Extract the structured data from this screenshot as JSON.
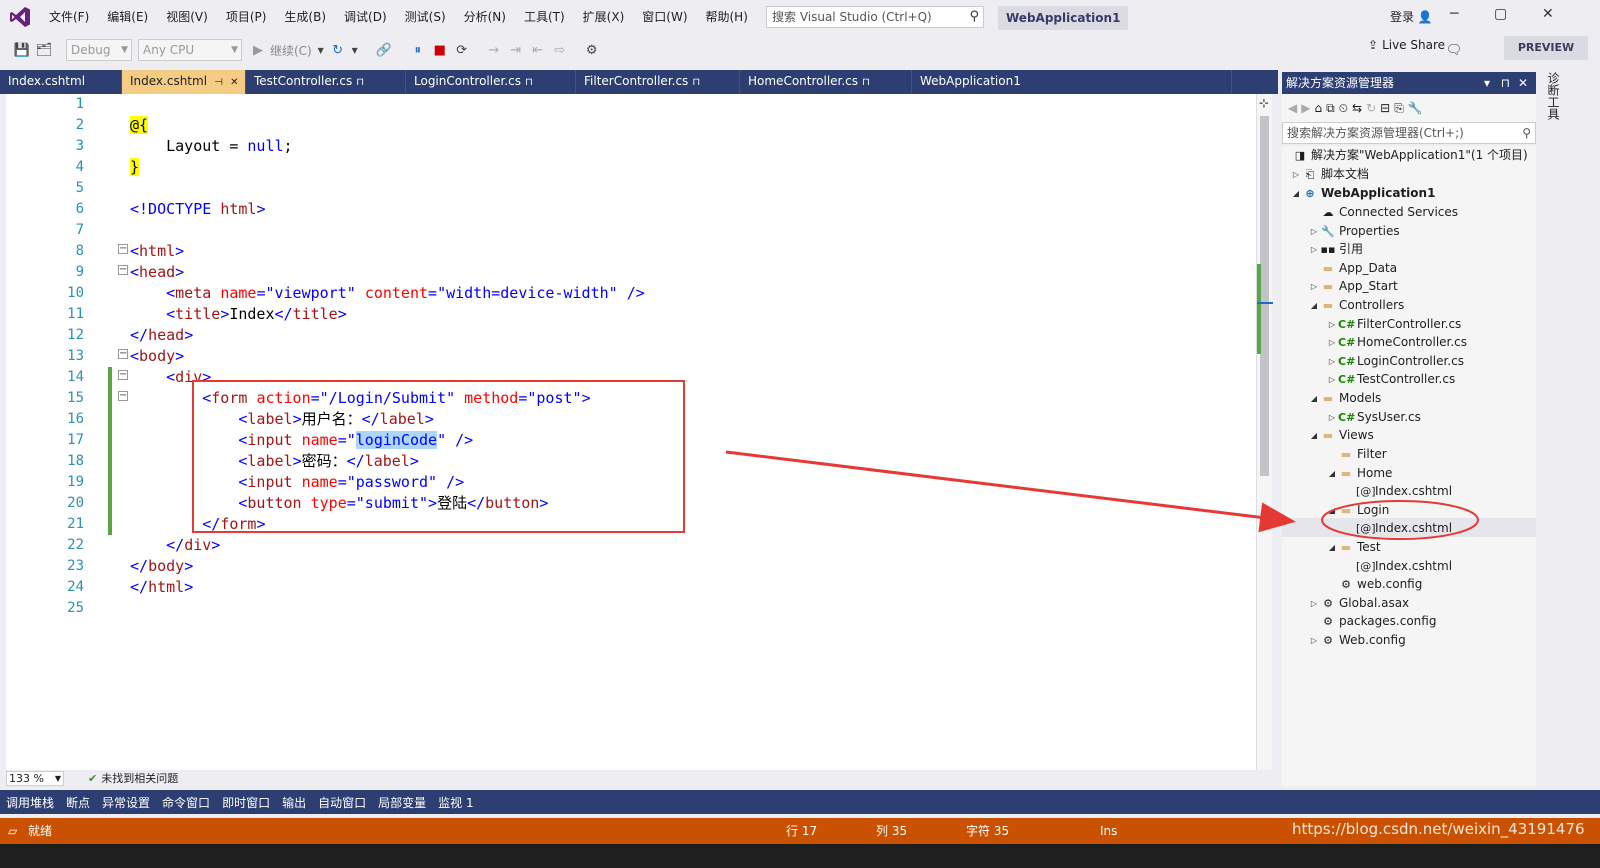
{
  "menubar": {
    "items": [
      "文件(F)",
      "编辑(E)",
      "视图(V)",
      "项目(P)",
      "生成(B)",
      "调试(D)",
      "测试(S)",
      "分析(N)",
      "工具(T)",
      "扩展(X)",
      "窗口(W)",
      "帮助(H)"
    ],
    "search_placeholder": "搜索 Visual Studio (Ctrl+Q)",
    "app_title": "WebApplication1",
    "login": "登录"
  },
  "toolbar": {
    "config": "Debug",
    "platform": "Any CPU",
    "continue": "继续(C)",
    "live_share": "Live Share",
    "preview": "PREVIEW"
  },
  "tabs": [
    {
      "label": "Index.cshtml"
    },
    {
      "label": "Index.cshtml",
      "active": true
    },
    {
      "label": "TestController.cs"
    },
    {
      "label": "LoginController.cs"
    },
    {
      "label": "FilterController.cs"
    },
    {
      "label": "HomeController.cs"
    },
    {
      "label": "WebApplication1"
    }
  ],
  "editor": {
    "line_numbers": [
      "1",
      "2",
      "3",
      "4",
      "5",
      "6",
      "7",
      "8",
      "9",
      "10",
      "11",
      "12",
      "13",
      "14",
      "15",
      "16",
      "17",
      "18",
      "19",
      "20",
      "21",
      "22",
      "23",
      "24",
      "25"
    ],
    "lines": {
      "l2": "@{",
      "l3a": "Layout = ",
      "l3b": "null",
      "l3c": ";",
      "l4": "}",
      "l6a": "<!DOCTYPE ",
      "l6b": "html",
      "l6c": ">",
      "l8": "html",
      "l9": "head",
      "l10_tag": "meta",
      "l10_a1": "name",
      "l10_v1": "\"viewport\"",
      "l10_a2": "content",
      "l10_v2": "\"width=device-width\"",
      "l11_tag": "title",
      "l11_text": "Index",
      "l12": "head",
      "l13": "body",
      "l14": "div",
      "l15_tag": "form",
      "l15_a1": "action",
      "l15_v1": "\"/Login/Submit\"",
      "l15_a2": "method",
      "l15_v2": "\"post\"",
      "l16_tag": "label",
      "l16_text": "用户名：",
      "l17_tag": "input",
      "l17_a1": "name",
      "l17_v1a": "\"",
      "l17_v1sel": "loginCode",
      "l17_v1b": "\"",
      "l18_tag": "label",
      "l18_text": "密码：",
      "l19_tag": "input",
      "l19_a1": "name",
      "l19_v1": "\"password\"",
      "l20_tag": "button",
      "l20_a1": "type",
      "l20_v1": "\"submit\"",
      "l20_text": "登陆",
      "l21": "form",
      "l22": "div",
      "l23": "body",
      "l24": "html"
    },
    "zoom": "133 %",
    "issues": "未找到相关问题"
  },
  "bottom_tabs": [
    "调用堆栈",
    "断点",
    "异常设置",
    "命令窗口",
    "即时窗口",
    "输出",
    "自动窗口",
    "局部变量",
    "监视 1"
  ],
  "statusbar": {
    "ready": "就绪",
    "line": "行 17",
    "col": "列 35",
    "char": "字符 35",
    "ins": "Ins",
    "watermark": "https://blog.csdn.net/weixin_43191476"
  },
  "solution_explorer": {
    "title": "解决方案资源管理器",
    "search_placeholder": "搜索解决方案资源管理器(Ctrl+;)",
    "side_tab": "诊断工具",
    "nodes": [
      {
        "label": "解决方案\"WebApplication1\"(1 个项目)"
      },
      {
        "label": "脚本文档"
      },
      {
        "label": "WebApplication1"
      },
      {
        "label": "Connected Services"
      },
      {
        "label": "Properties"
      },
      {
        "label": "引用"
      },
      {
        "label": "App_Data"
      },
      {
        "label": "App_Start"
      },
      {
        "label": "Controllers"
      },
      {
        "label": "FilterController.cs"
      },
      {
        "label": "HomeController.cs"
      },
      {
        "label": "LoginController.cs"
      },
      {
        "label": "TestController.cs"
      },
      {
        "label": "Models"
      },
      {
        "label": "SysUser.cs"
      },
      {
        "label": "Views"
      },
      {
        "label": "Filter"
      },
      {
        "label": "Home"
      },
      {
        "label": "Index.cshtml"
      },
      {
        "label": "Login"
      },
      {
        "label": "Index.cshtml"
      },
      {
        "label": "Test"
      },
      {
        "label": "Index.cshtml"
      },
      {
        "label": "web.config"
      },
      {
        "label": "Global.asax"
      },
      {
        "label": "packages.config"
      },
      {
        "label": "Web.config"
      }
    ]
  },
  "colors": {
    "accent": "#2d3e73",
    "status": "#ca5100",
    "annotation": "#e53935"
  }
}
